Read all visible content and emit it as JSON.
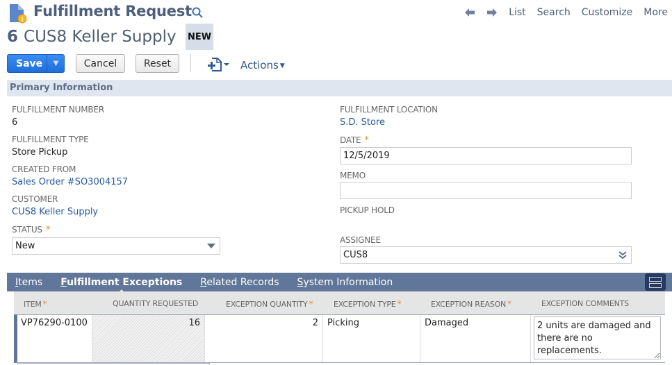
{
  "header": {
    "record_type": "Fulfillment Request",
    "record_number": "6",
    "record_name": "CUS8 Keller Supply",
    "status_badge": "NEW",
    "nav": {
      "back_icon": "arrow-left-icon",
      "forward_icon": "arrow-right-icon",
      "links": [
        "List",
        "Search",
        "Customize",
        "More"
      ]
    }
  },
  "toolbar": {
    "save_label": "Save",
    "cancel_label": "Cancel",
    "reset_label": "Reset",
    "new_record_icon": "new-document-plus-icon",
    "actions_label": "Actions"
  },
  "primary": {
    "section_title": "Primary Information",
    "left": [
      {
        "label": "FULFILLMENT NUMBER",
        "value": "6"
      },
      {
        "label": "FULFILLMENT TYPE",
        "value": "Store Pickup"
      },
      {
        "label": "CREATED FROM",
        "value": "Sales Order #SO3004157"
      },
      {
        "label": "CUSTOMER",
        "value": "CUS8 Keller Supply"
      }
    ],
    "status": {
      "label": "STATUS",
      "required": "*",
      "value": "New"
    },
    "fulfillment_location": {
      "label": "FULFILLMENT LOCATION",
      "value": "S.D. Store"
    },
    "date": {
      "label": "DATE",
      "required": "*",
      "value": "12/5/2019"
    },
    "memo": {
      "label": "MEMO",
      "value": ""
    },
    "pickup_hold": {
      "label": "PICKUP HOLD"
    },
    "assignee": {
      "label": "ASSIGNEE",
      "value": "CUS8"
    }
  },
  "subtabs": [
    {
      "key": "I",
      "rest": "tems",
      "active": false
    },
    {
      "key": "F",
      "rest": "ulfillment Exceptions",
      "active": true
    },
    {
      "key": "R",
      "rest": "elated Records",
      "active": false
    },
    {
      "key": "S",
      "rest": "ystem Information",
      "active": false
    }
  ],
  "exceptions": {
    "columns": [
      {
        "label": "ITEM",
        "required": "*"
      },
      {
        "label": "QUANTITY REQUESTED",
        "required": ""
      },
      {
        "label": "EXCEPTION QUANTITY",
        "required": "*"
      },
      {
        "label": "EXCEPTION TYPE",
        "required": "*"
      },
      {
        "label": "EXCEPTION REASON",
        "required": "*"
      },
      {
        "label": "EXCEPTION COMMENTS",
        "required": ""
      }
    ],
    "rows": [
      {
        "item": "VP76290-0100",
        "quantity_requested": "16",
        "exception_quantity": "2",
        "exception_type": "Picking",
        "exception_reason": "Damaged",
        "exception_comments": "2 units are damaged and there are no replacements."
      }
    ]
  },
  "colors": {
    "title": "#4d5f7c",
    "link": "#255a9b",
    "primary_button": "#1f6fdc",
    "section_bg": "#e0e6ef",
    "subtab_bar": "#607799",
    "required": "#d49328"
  }
}
